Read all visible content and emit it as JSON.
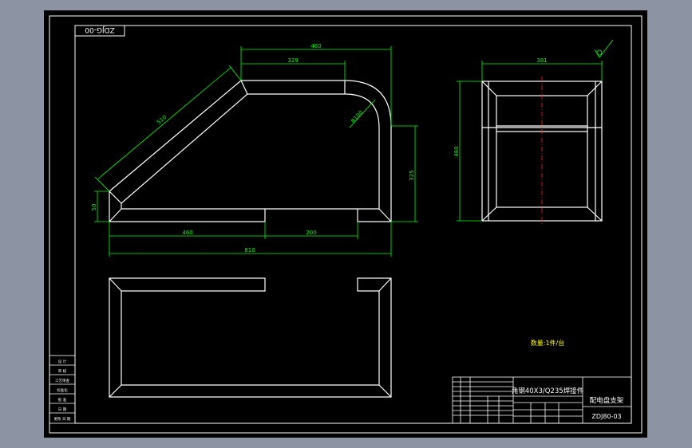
{
  "drawing": {
    "code_stamp": "ZDJG-00",
    "colors": {
      "viewport_bg": "#8c93a3",
      "sheet_bg": "#000000",
      "lines": "#ffffff",
      "dimensions": "#00ff00",
      "centerline": "#ff2020",
      "notes": "#ffff00"
    },
    "front_view": {
      "dims": {
        "top_overall": "460",
        "top_straight": "329",
        "diagonal": "510",
        "radius": "R100",
        "right_height": "325",
        "left_height": "50",
        "bottom_left": "460",
        "bottom_right": "200",
        "bottom_overall": "810"
      }
    },
    "side_view": {
      "dims": {
        "width": "381",
        "height": "480"
      }
    },
    "note": "数量:1件/台",
    "title_block": {
      "material": "角钢40X3/Q235焊接件",
      "part_name": "配电盘支架",
      "drawing_no": "ZDJ80-03"
    },
    "left_strip": {
      "labels": [
        "设 计",
        "审 核",
        "工艺审查",
        "标准化",
        "批 准",
        "日 期",
        "更改 日 期"
      ]
    }
  }
}
